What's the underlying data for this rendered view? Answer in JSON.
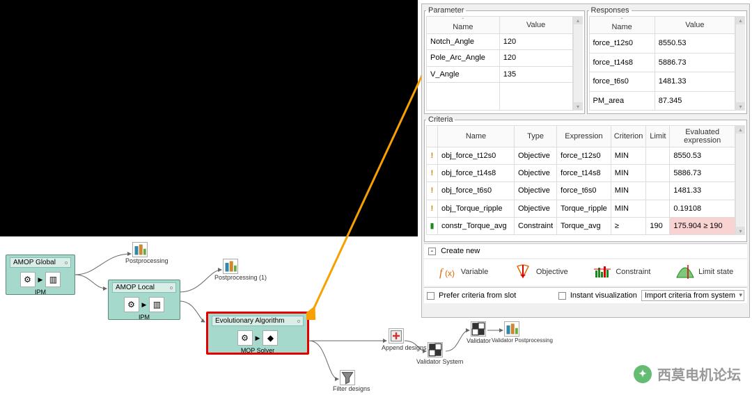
{
  "workflow": {
    "amop_global": {
      "title": "AMOP Global",
      "sub": "IPM"
    },
    "amop_local": {
      "title": "AMOP Local",
      "sub": "IPM"
    },
    "evo": {
      "title": "Evolutionary Algorithm",
      "sub": "MOP Solver"
    },
    "postproc": "Postprocessing",
    "postproc1": "Postprocessing (1)",
    "append": "Append designs",
    "validator_post": "Validator Postprocessing",
    "validator_sys": "Validator System",
    "filter": "Filter designs"
  },
  "parameter": {
    "legend": "Parameter",
    "headers": {
      "name": "Name",
      "value": "Value"
    },
    "rows": [
      {
        "name": "Notch_Angle",
        "value": "120"
      },
      {
        "name": "Pole_Arc_Angle",
        "value": "120"
      },
      {
        "name": "V_Angle",
        "value": "135"
      }
    ]
  },
  "responses": {
    "legend": "Responses",
    "headers": {
      "name": "Name",
      "value": "Value"
    },
    "rows": [
      {
        "name": "force_t12s0",
        "value": "8550.53"
      },
      {
        "name": "force_t14s8",
        "value": "5886.73"
      },
      {
        "name": "force_t6s0",
        "value": "1481.33"
      },
      {
        "name": "PM_area",
        "value": "87.345"
      }
    ]
  },
  "criteria": {
    "legend": "Criteria",
    "headers": {
      "name": "Name",
      "type": "Type",
      "expr": "Expression",
      "crit": "Criterion",
      "limit": "Limit",
      "eval": "Evaluated expression"
    },
    "rows": [
      {
        "icon": "warn",
        "name": "obj_force_t12s0",
        "type": "Objective",
        "expr": "force_t12s0",
        "crit": "MIN",
        "limit": "",
        "eval": "8550.53"
      },
      {
        "icon": "warn",
        "name": "obj_force_t14s8",
        "type": "Objective",
        "expr": "force_t14s8",
        "crit": "MIN",
        "limit": "",
        "eval": "5886.73"
      },
      {
        "icon": "warn",
        "name": "obj_force_t6s0",
        "type": "Objective",
        "expr": "force_t6s0",
        "crit": "MIN",
        "limit": "",
        "eval": "1481.33"
      },
      {
        "icon": "warn",
        "name": "obj_Torque_ripple",
        "type": "Objective",
        "expr": "Torque_ripple",
        "crit": "MIN",
        "limit": "",
        "eval": "0.19108"
      },
      {
        "icon": "ok",
        "name": "constr_Torque_avg",
        "type": "Constraint",
        "expr": "Torque_avg",
        "crit": "≥",
        "limit": "190",
        "eval": "175.904 ≥ 190",
        "fail": true
      }
    ]
  },
  "create": {
    "label": "Create new",
    "variable": "Variable",
    "objective": "Objective",
    "constraint": "Constraint",
    "limit": "Limit state"
  },
  "footer": {
    "prefer": "Prefer criteria from slot",
    "instant": "Instant visualization",
    "import": "Import criteria from system"
  },
  "watermark": "西莫电机论坛"
}
